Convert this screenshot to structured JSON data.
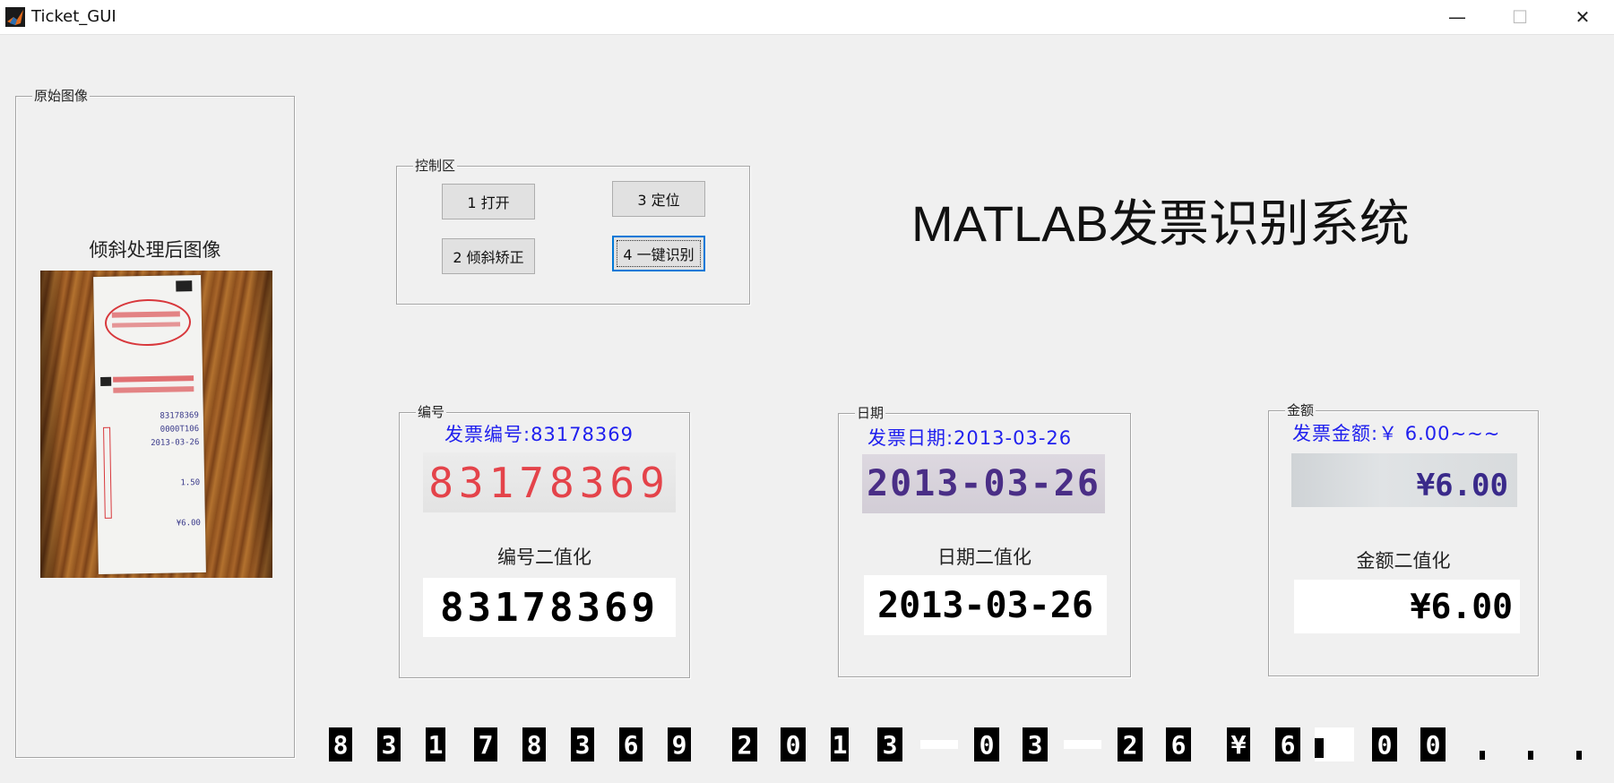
{
  "window": {
    "title": "Ticket_GUI",
    "minimize": "—",
    "maximize": "☐",
    "close": "✕"
  },
  "panels": {
    "original": "原始图像",
    "control": "控制区",
    "number": "编号",
    "date": "日期",
    "amount": "金额"
  },
  "left_image_label": "倾斜处理后图像",
  "buttons": {
    "open": "1 打开",
    "locate": "3 定位",
    "deskew": "2 倾斜矫正",
    "one_click": "4 一键识别"
  },
  "system_title": "MATLAB发票识别系统",
  "number_section": {
    "result": "发票编号:83178369",
    "crop_text": "83178369",
    "binary_label": "编号二值化",
    "binary_text": "83178369"
  },
  "date_section": {
    "result": "发票日期:2013-03-26",
    "crop_text": "2013-03-26",
    "binary_label": "日期二值化",
    "binary_text": "2013-03-26"
  },
  "amount_section": {
    "result": "发票金额:￥ 6.00~~~",
    "crop_text": "¥6.00",
    "binary_label": "金额二值化",
    "binary_text": "¥6.00"
  },
  "segmented_chars": [
    "8",
    "3",
    "1",
    "7",
    "8",
    "3",
    "6",
    "9",
    "2",
    "0",
    "1",
    "3",
    "-",
    "0",
    "3",
    "-",
    "2",
    "6",
    "¥",
    "6",
    "",
    "0",
    "0",
    ".",
    ".",
    "."
  ],
  "receipt_lines": [
    "83178369",
    "0000T106",
    "2013-03-26",
    "1.50",
    "¥6.00"
  ],
  "colors": {
    "accent": "#0078d7",
    "result_blue": "#2020ee",
    "red_digits": "#e4434a",
    "purple_digits": "#4a2e86"
  }
}
